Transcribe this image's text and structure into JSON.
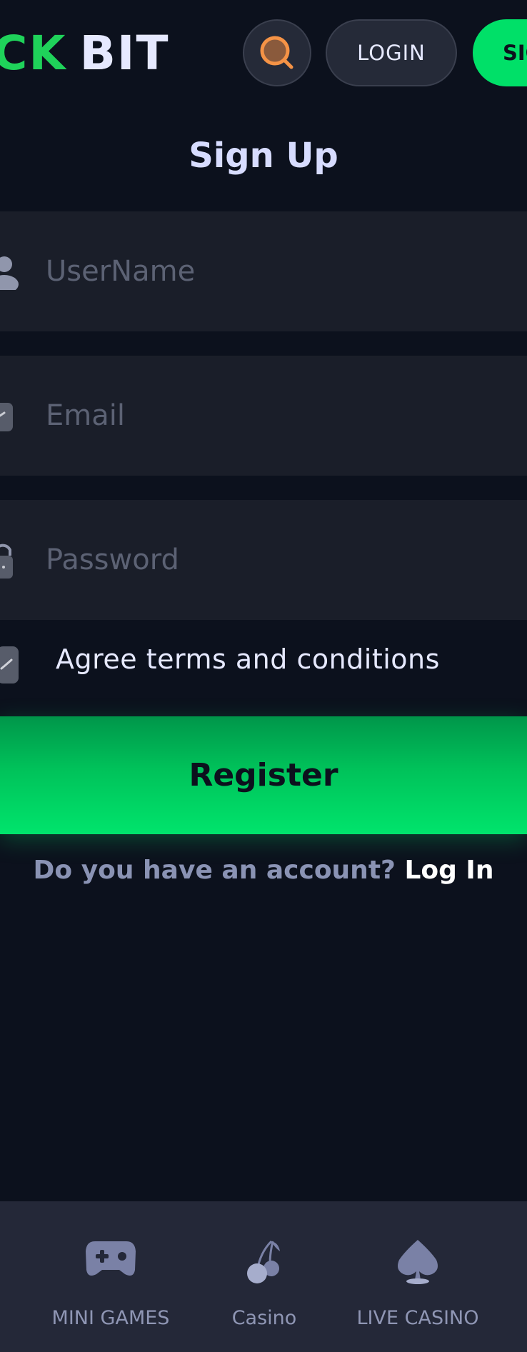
{
  "header": {
    "logo_left": "CK",
    "logo_right": "BIT",
    "login_label": "LOGIN",
    "signup_label": "SIGN UP"
  },
  "form": {
    "title": "Sign Up",
    "username_placeholder": "UserName",
    "email_placeholder": "Email",
    "password_placeholder": "Password",
    "agree_label": "Agree terms and conditions",
    "agree_checked": true,
    "register_label": "Register",
    "account_question": "Do you have an account?",
    "login_link": "Log In"
  },
  "bottom_nav": {
    "items": [
      {
        "label": "MINI GAMES",
        "icon": "gamepad-icon"
      },
      {
        "label": "Casino",
        "icon": "cherry-icon"
      },
      {
        "label": "LIVE CASINO",
        "icon": "spade-icon"
      }
    ]
  },
  "colors": {
    "background": "#0c111d",
    "field": "#1a1e29",
    "accent": "#00e068",
    "text": "#e6e9ff",
    "nav": "#242838"
  }
}
